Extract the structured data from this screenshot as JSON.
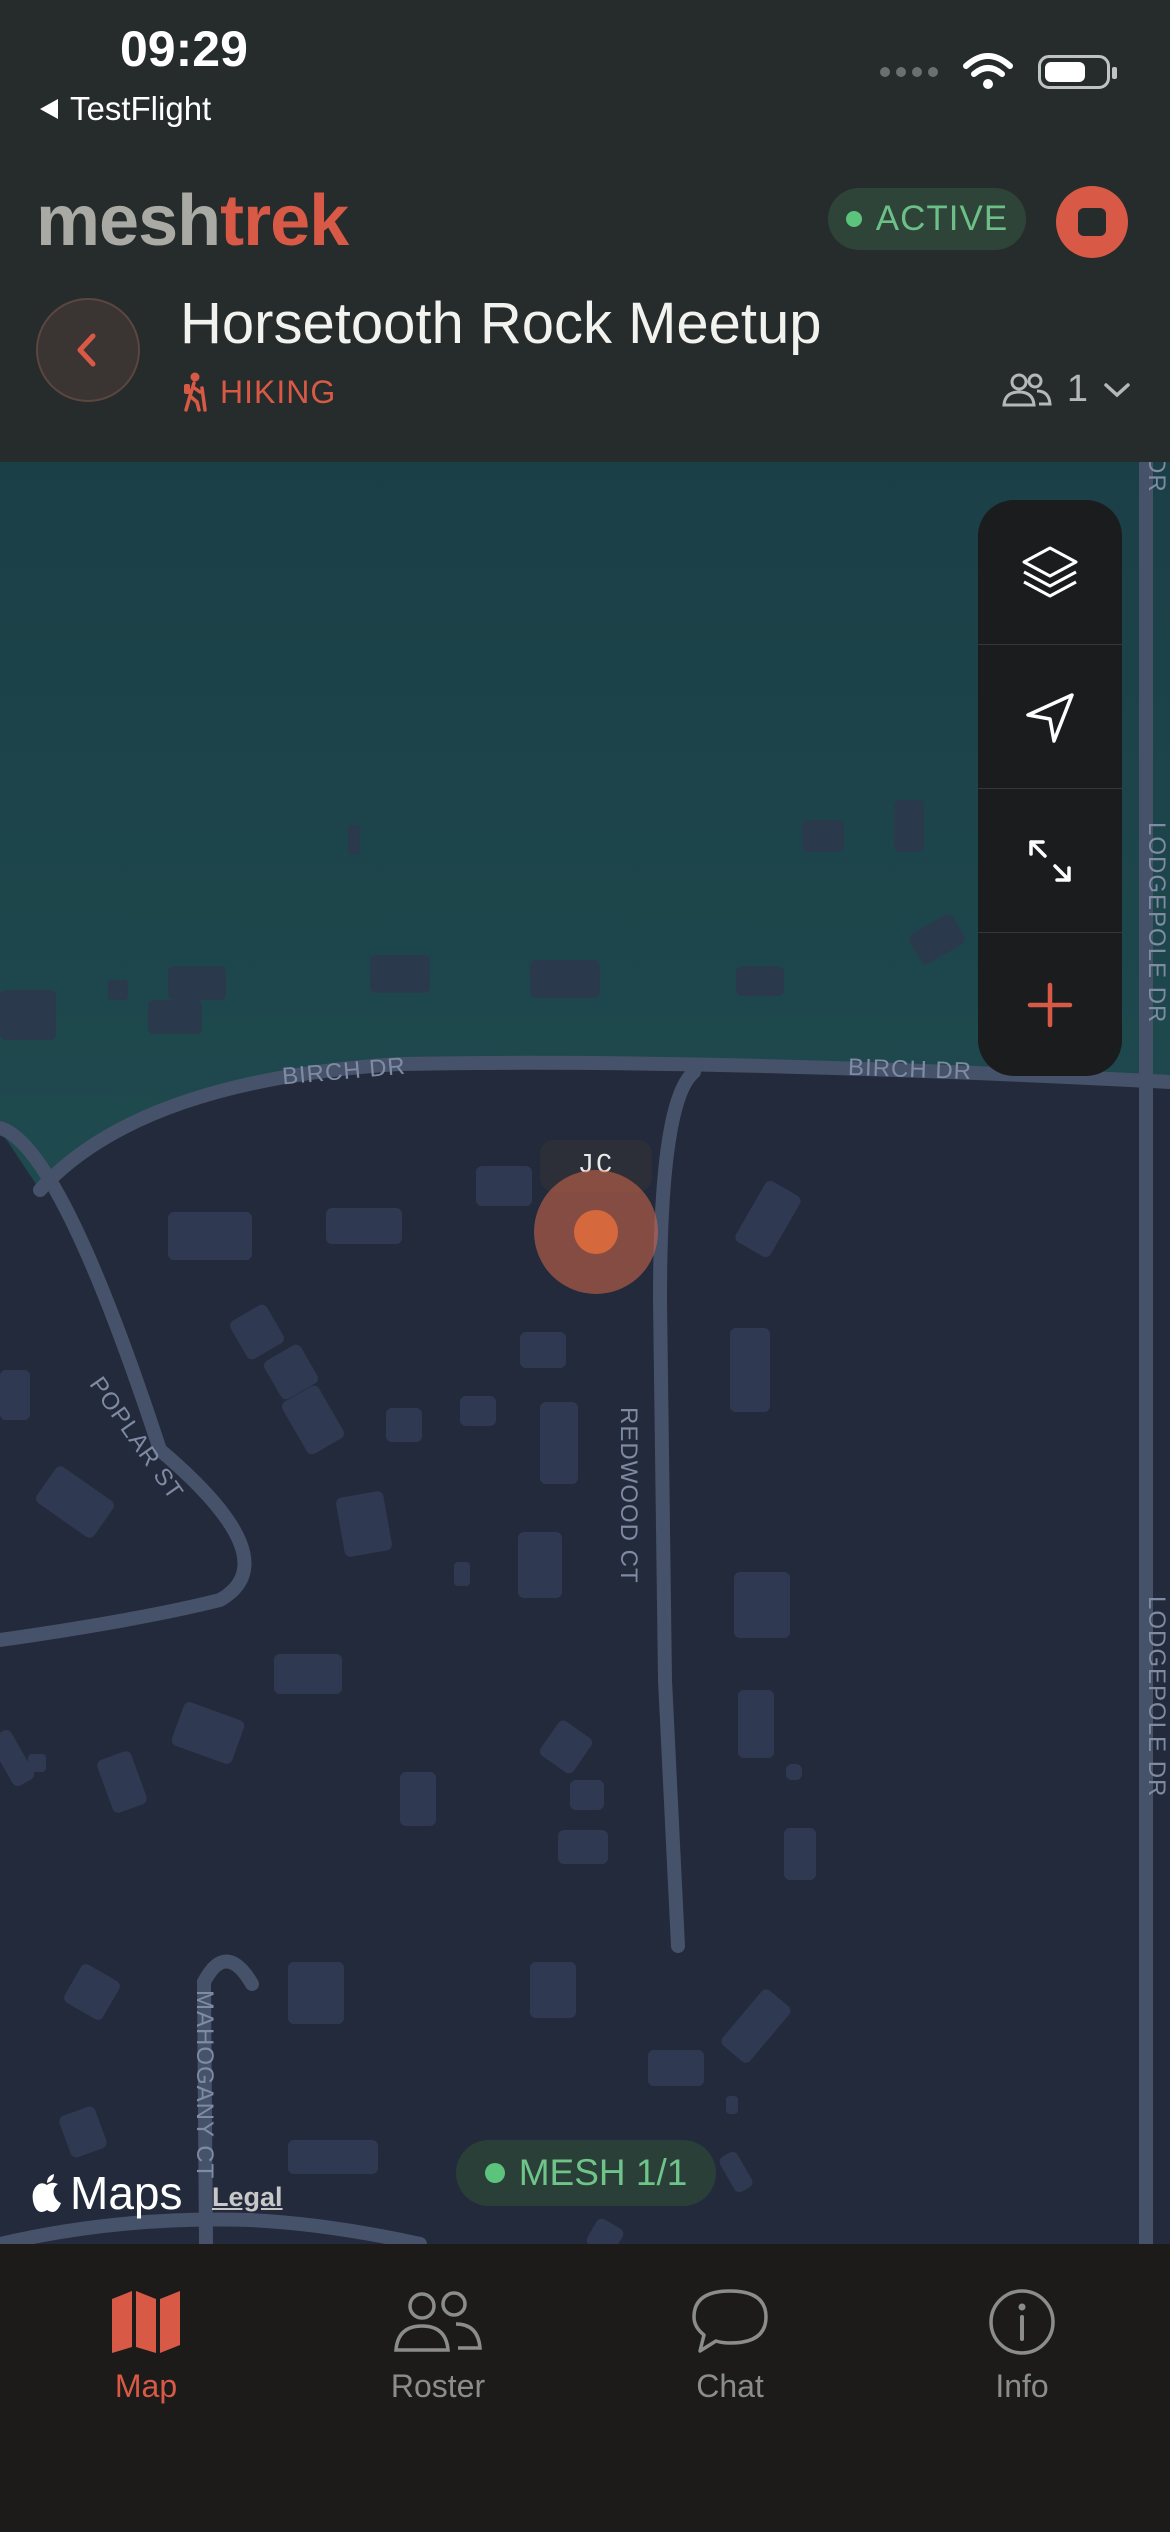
{
  "status_bar": {
    "time": "09:29",
    "back_app": "TestFlight"
  },
  "header": {
    "brand_part1": "mesh",
    "brand_part2": "trek",
    "status": "ACTIVE",
    "title": "Horsetooth Rock Meetup",
    "activity": "HIKING",
    "member_count": "1"
  },
  "map": {
    "streets": {
      "birch_left": "BIRCH DR",
      "birch_right": "BIRCH DR",
      "poplar": "POPLAR ST",
      "redwood": "REDWOOD CT",
      "lodgepole_top": "LODGEPOLE DR",
      "lodgepole_bottom": "LODGEPOLE DR",
      "mahogany": "MAHOGANY CT",
      "edge_dr": "DR"
    },
    "user_marker": "JC",
    "mesh_status": "MESH 1/1",
    "attribution": "Maps",
    "legal": "Legal"
  },
  "controls": [
    "layers-icon",
    "locate-icon",
    "expand-icon",
    "add-icon"
  ],
  "tabs": [
    {
      "label": "Map",
      "icon": "map-icon",
      "active": true
    },
    {
      "label": "Roster",
      "icon": "people-icon",
      "active": false
    },
    {
      "label": "Chat",
      "icon": "chat-bubble-icon",
      "active": false
    },
    {
      "label": "Info",
      "icon": "info-icon",
      "active": false
    }
  ],
  "colors": {
    "accent": "#d85a46",
    "active_green": "#5cc37c",
    "header_bg": "#262b2b",
    "map_land": "#222a3b",
    "map_water": "#1c4146"
  }
}
